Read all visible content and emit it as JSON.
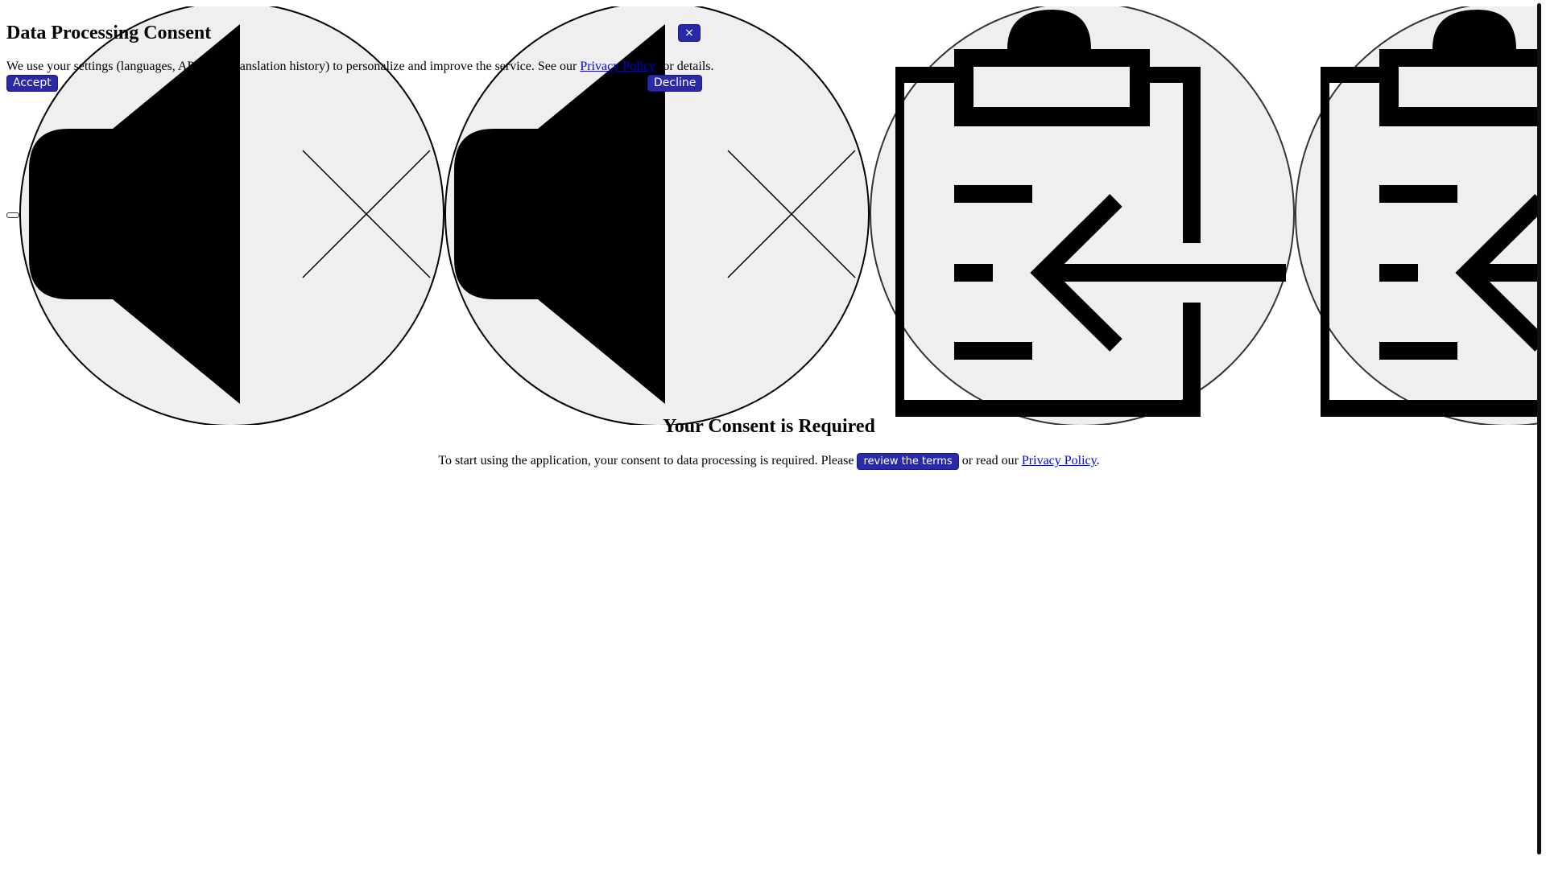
{
  "banner": {
    "title": "Data Processing Consent",
    "close_label": "×",
    "text_before": "We use your settings (languages, API keys, translation history) to personalize and improve the service. See our ",
    "policy_link": "Privacy Policy",
    "text_after": " for details.",
    "accept_label": "Accept",
    "decline_label": "Decline"
  },
  "icons": [
    "speaker-muted-icon",
    "speaker-muted-icon",
    "clipboard-import-icon",
    "clipboard-import-icon"
  ],
  "required": {
    "title": "Your Consent is Required",
    "text_before": "To start using the application, your consent to data processing is required. Please ",
    "terms_label": "review the terms",
    "text_middle": " or read our ",
    "policy_link": "Privacy Policy",
    "text_after": "."
  },
  "colors": {
    "button_bg": "#2b2aa6",
    "link": "#0000ee",
    "icon_circle_bg": "#efefef"
  }
}
